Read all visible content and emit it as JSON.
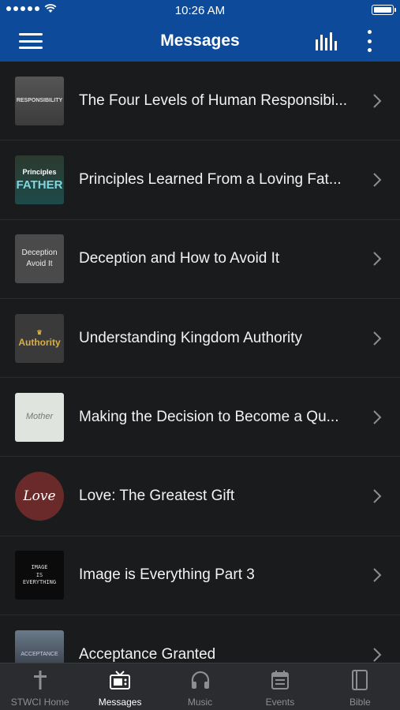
{
  "status": {
    "time": "10:26 AM"
  },
  "header": {
    "title": "Messages"
  },
  "messages": [
    {
      "title": "The Four Levels of Human Responsibi...",
      "thumb_text": "RESPONSIBILITY"
    },
    {
      "title": "Principles Learned From a Loving Fat...",
      "thumb_text_1": "Principles",
      "thumb_text_2": "FATHER"
    },
    {
      "title": "Deception and How to Avoid It",
      "thumb_text_1": "Deception",
      "thumb_text_2": "Avoid It"
    },
    {
      "title": "Understanding Kingdom Authority",
      "thumb_text": "Authority"
    },
    {
      "title": "Making the Decision to Become a Qu...",
      "thumb_text": "Mother"
    },
    {
      "title": "Love: The Greatest Gift",
      "thumb_text": "Love"
    },
    {
      "title": "Image is Everything Part 3",
      "thumb_text_1": "IMAGE",
      "thumb_text_2": "IS",
      "thumb_text_3": "EVERYTHING"
    },
    {
      "title": "Acceptance Granted",
      "thumb_text": "ACCEPTANCE"
    }
  ],
  "tabs": [
    {
      "label": "STWCI Home",
      "icon": "cross-icon"
    },
    {
      "label": "Messages",
      "icon": "tv-icon",
      "active": true
    },
    {
      "label": "Music",
      "icon": "headphones-icon"
    },
    {
      "label": "Events",
      "icon": "calendar-icon"
    },
    {
      "label": "Bible",
      "icon": "book-icon"
    }
  ],
  "colors": {
    "header": "#0d4a9a",
    "background": "#1a1b1d",
    "tabbar": "#2b2c2f",
    "tab_inactive": "#8e8e92",
    "tab_active": "#ffffff"
  }
}
